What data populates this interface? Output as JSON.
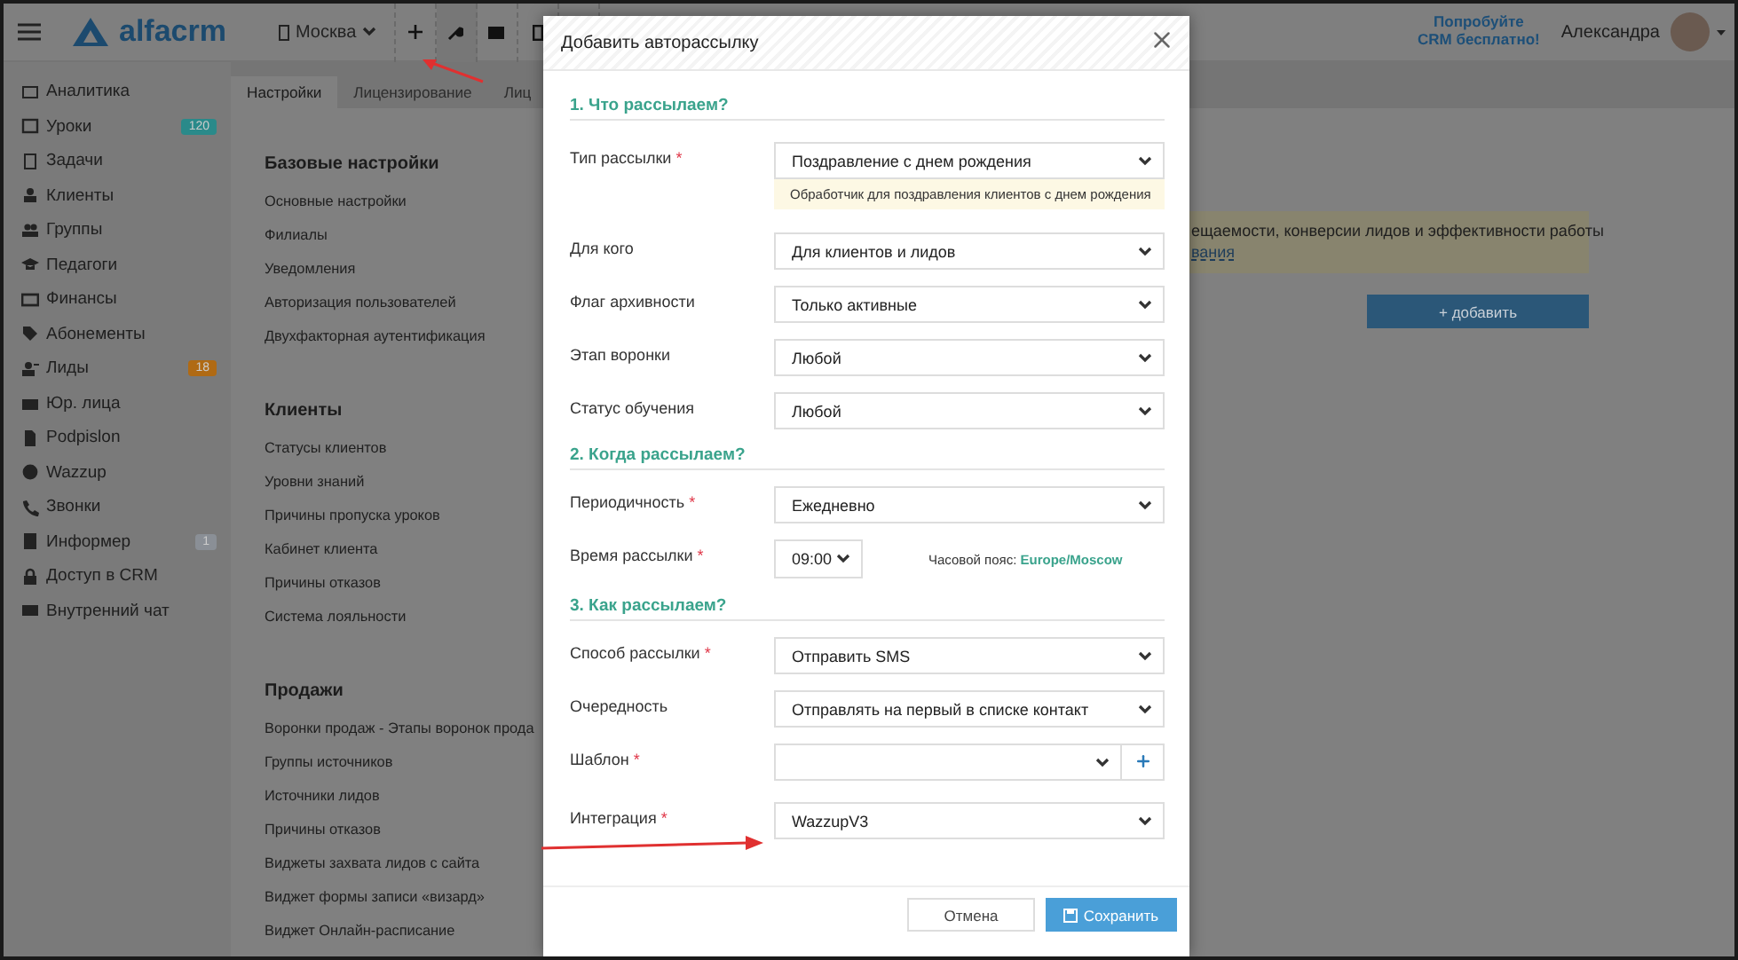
{
  "topbar": {
    "brand": "alfacrm",
    "branch": "Москва",
    "promo_line1": "Попробуйте",
    "promo_line2": "CRM бесплатно!",
    "user": "Александра"
  },
  "sidebar": {
    "items": [
      {
        "label": "Аналитика"
      },
      {
        "label": "Уроки",
        "badge": "120",
        "color": "#2a8a8a"
      },
      {
        "label": "Задачи"
      },
      {
        "label": "Клиенты"
      },
      {
        "label": "Группы"
      },
      {
        "label": "Педагоги"
      },
      {
        "label": "Финансы"
      },
      {
        "label": "Абонементы"
      },
      {
        "label": "Лиды",
        "badge": "18",
        "color": "#b06a14"
      },
      {
        "label": "Юр. лица"
      },
      {
        "label": "Podpislon"
      },
      {
        "label": "Wazzup"
      },
      {
        "label": "Звонки"
      },
      {
        "label": "Информер",
        "badge": "1",
        "color": "#8a8f96"
      },
      {
        "label": "Доступ в CRM"
      },
      {
        "label": "Внутренний чат"
      }
    ]
  },
  "tabs": [
    {
      "label": "Настройки",
      "selected": true
    },
    {
      "label": "Лицензирование",
      "selected": false
    },
    {
      "label": "Лиц",
      "selected": false
    }
  ],
  "settings_groups": [
    {
      "title": "Базовые настройки",
      "links": [
        "Основные настройки",
        "Филиалы",
        "Уведомления",
        "Авторизация пользователей",
        "Двухфакторная аутентификация"
      ]
    },
    {
      "title": "Клиенты",
      "links": [
        "Статусы клиентов",
        "Уровни знаний",
        "Причины пропуска уроков",
        "Кабинет клиента",
        "Причины отказов",
        "Система лояльности"
      ]
    },
    {
      "title": "Продажи",
      "links": [
        "Воронки продаж - Этапы воронок прода",
        "Группы источников",
        "Источники лидов",
        "Причины отказов",
        "Виджеты захвата лидов с сайта",
        "Виджет формы записи «визард»",
        "Виджет Онлайн-расписание"
      ]
    }
  ],
  "notice": {
    "text": "ещаемости, конверсии лидов и эффективности работы",
    "link": "вания"
  },
  "add_button": "+ добавить",
  "modal": {
    "title": "Добавить авторассылку",
    "sections": [
      {
        "title": "1. Что рассылаем?",
        "fields": [
          {
            "kind": "select",
            "label": "Тип рассылки",
            "mark": "*",
            "value": "Поздравление с днем рождения",
            "hint": "Обработчик для поздравления клиентов с днем рождения"
          },
          {
            "kind": "select",
            "label": "Для кого",
            "value": "Для клиентов и лидов"
          },
          {
            "kind": "select",
            "label": "Флаг архивности",
            "value": "Только активные"
          },
          {
            "kind": "select",
            "label": "Этап воронки",
            "value": "Любой"
          },
          {
            "kind": "select",
            "label": "Статус обучения",
            "value": "Любой"
          }
        ]
      },
      {
        "title": "2. Когда рассылаем?",
        "fields": [
          {
            "kind": "select",
            "label": "Периодичность",
            "mark": "*",
            "value": "Ежедневно"
          },
          {
            "kind": "time",
            "label": "Время рассылки",
            "mark": "*",
            "value": "09:00",
            "timezone_label": "Часовой пояс:",
            "timezone_value": "Europe/Moscow"
          }
        ]
      },
      {
        "title": "3. Как рассылаем?",
        "fields": [
          {
            "kind": "select",
            "label": "Способ рассылки",
            "mark": "*",
            "value": "Отправить SMS"
          },
          {
            "kind": "select",
            "label": "Очередность",
            "value": "Отправлять на первый в списке контакт"
          },
          {
            "kind": "select-add",
            "label": "Шаблон",
            "mark": "*"
          },
          {
            "kind": "select",
            "label": "Интеграция",
            "mark": "*",
            "value": "WazzupV3"
          }
        ]
      }
    ],
    "cancel": "Отмена",
    "save": "Сохранить"
  }
}
